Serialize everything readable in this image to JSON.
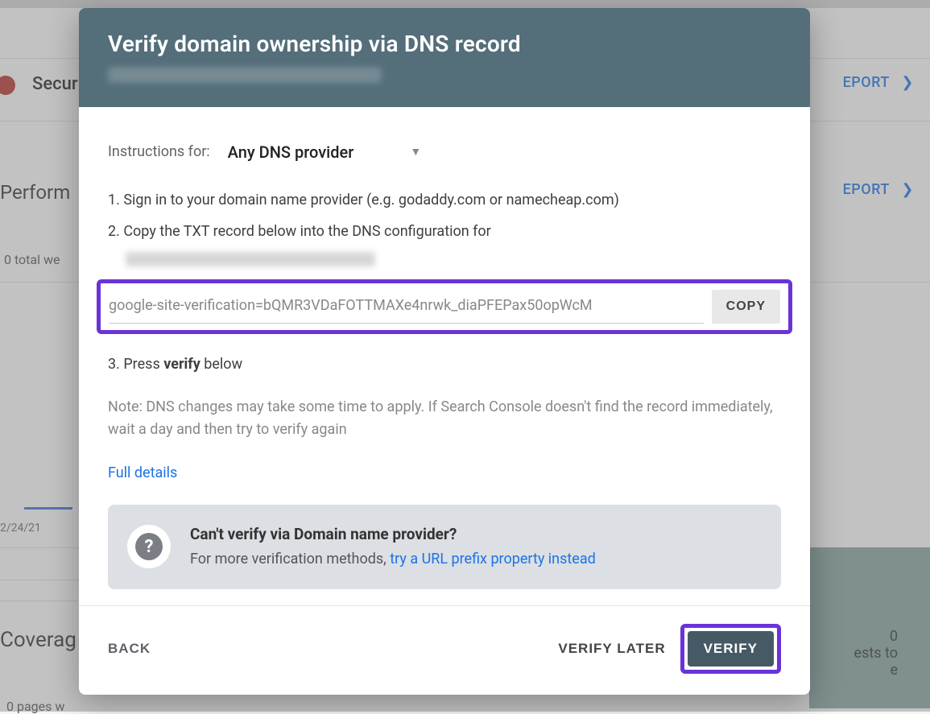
{
  "background": {
    "security": "Secur",
    "report": "EPORT",
    "performance": "Perform",
    "report2": "EPORT",
    "totalwe": "0 total we",
    "date": "2/24/21",
    "coverage": "Coverag",
    "pages": "0 pages w",
    "sideText1": "0",
    "sideText2": "ests to",
    "sideText3": "e"
  },
  "dialog": {
    "title": "Verify domain ownership via DNS record",
    "instructionsLabel": "Instructions for:",
    "dnsSelectLabel": "Any DNS provider",
    "step1": "1. Sign in to your domain name provider (e.g. godaddy.com or namecheap.com)",
    "step2": "2. Copy the TXT record below into the DNS configuration for",
    "txtRecord": "google-site-verification=bQMR3VDaFOTTMAXe4nrwk_diaPFEPax50opWcM",
    "copyLabel": "COPY",
    "step3a": "3. Press ",
    "step3bold": "verify",
    "step3b": " below",
    "note": "Note: DNS changes may take some time to apply. If Search Console doesn't find the record immediately, wait a day and then try to verify again",
    "fullDetails": "Full details",
    "altTitle": "Can't verify via Domain name provider?",
    "altBody": "For more verification methods, ",
    "altLink": "try a URL prefix property instead",
    "backLabel": "BACK",
    "verifyLaterLabel": "VERIFY LATER",
    "verifyLabel": "VERIFY"
  },
  "icons": {
    "chevron": "❯",
    "question": "?",
    "triangle": "▼"
  }
}
